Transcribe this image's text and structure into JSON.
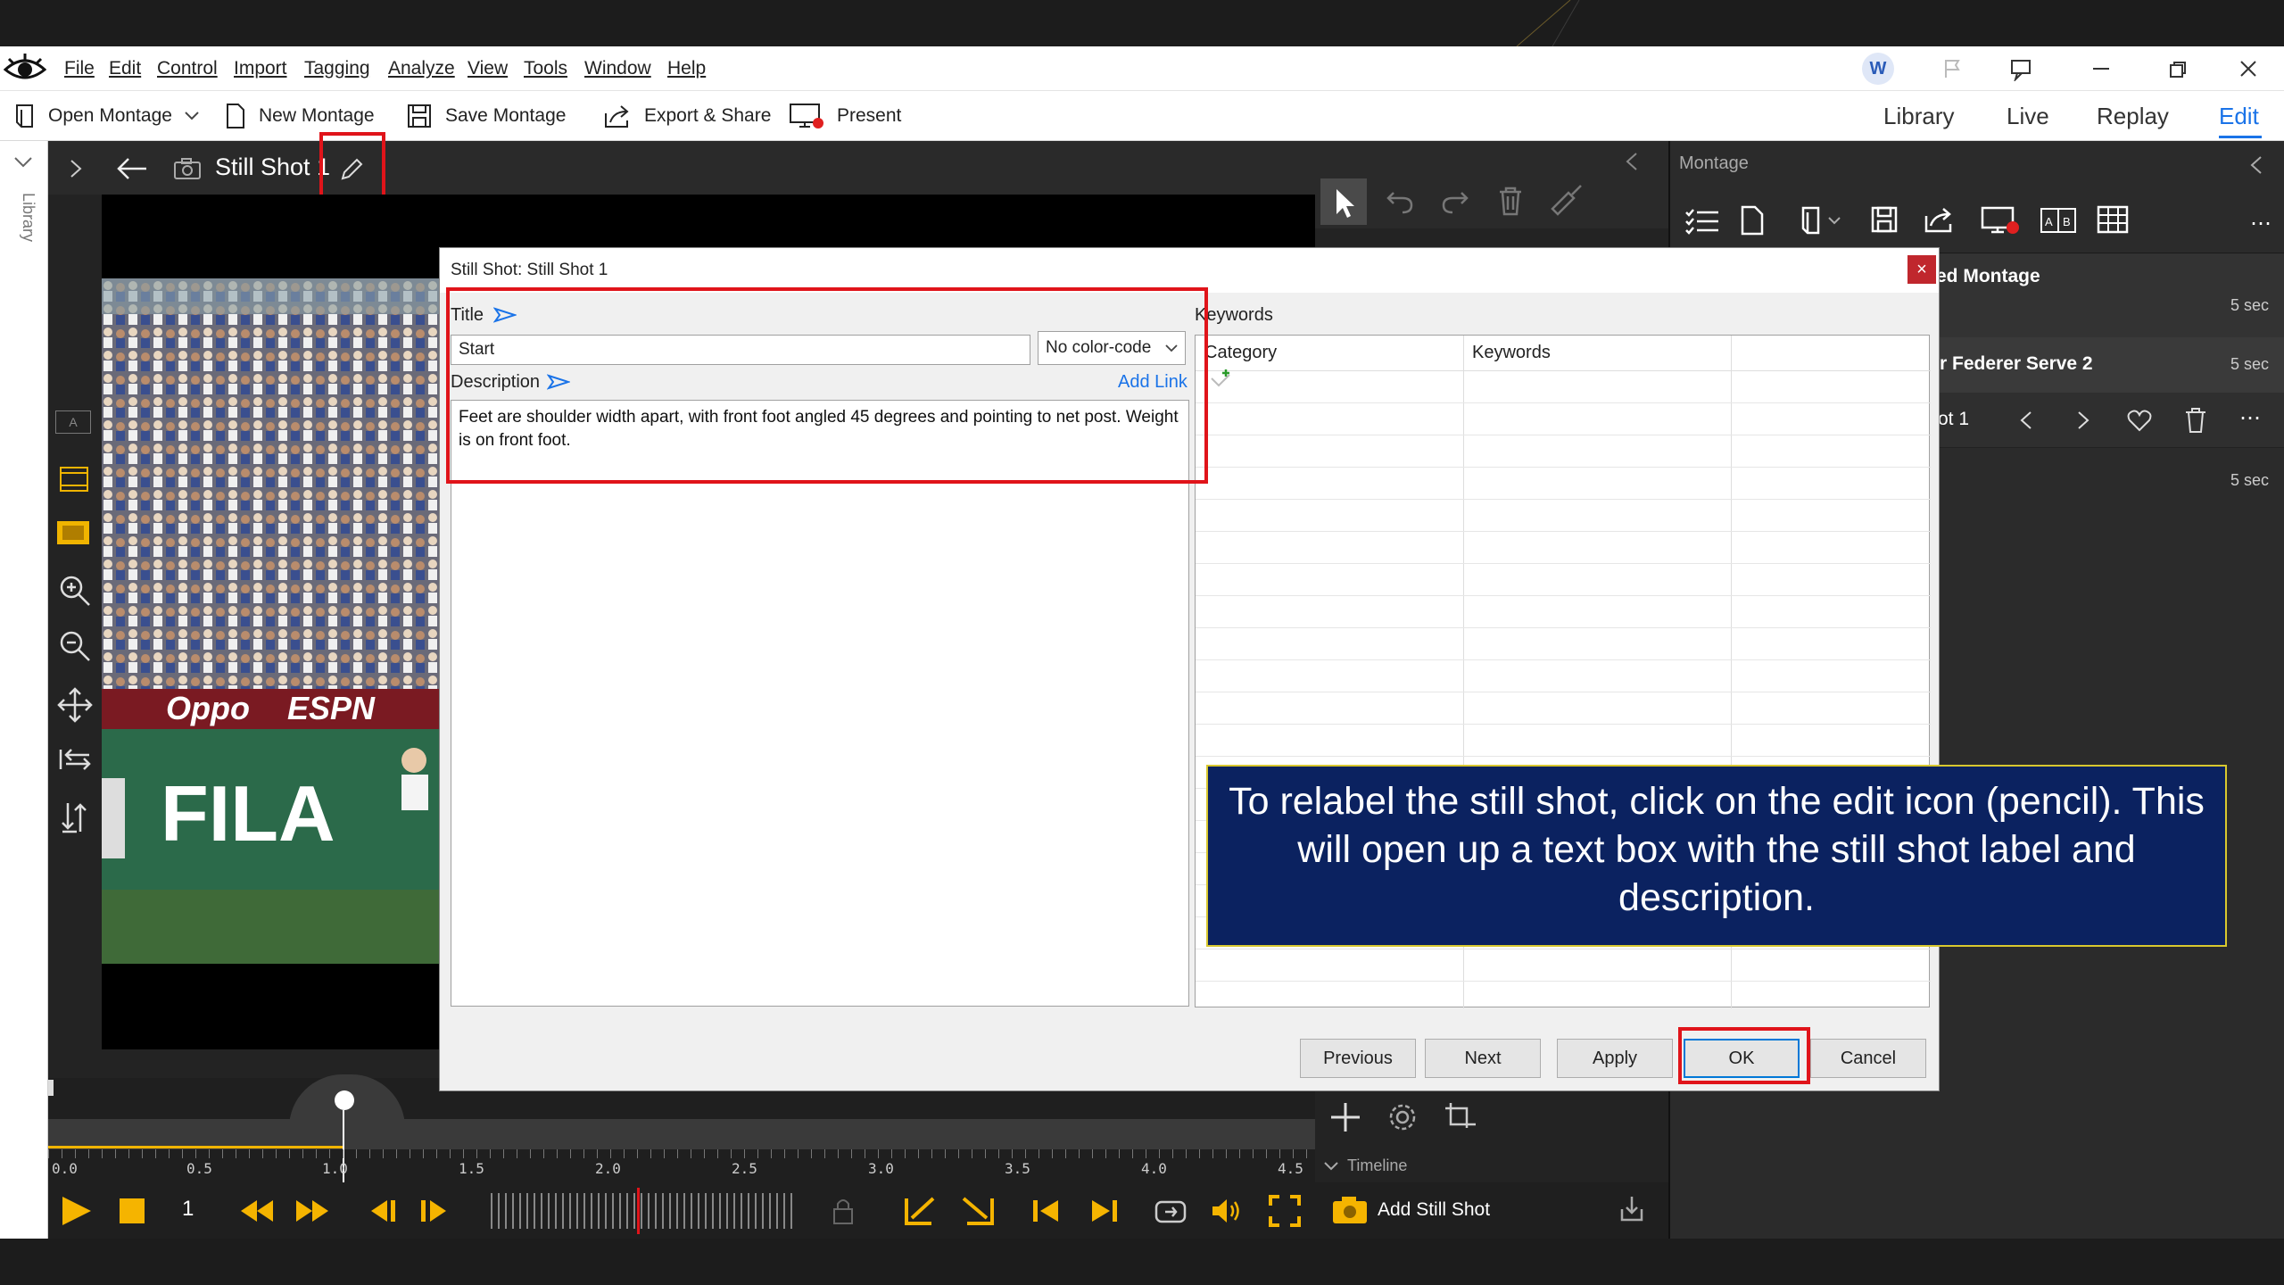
{
  "menu": {
    "items": [
      "File",
      "Edit",
      "Control",
      "Import",
      "Tagging",
      "Analyze",
      "View",
      "Tools",
      "Window",
      "Help"
    ],
    "avatar_letter": "W"
  },
  "toolbar": {
    "open_montage": "Open Montage",
    "new_montage": "New Montage",
    "save_montage": "Save Montage",
    "export_share": "Export & Share",
    "present": "Present",
    "tabs": [
      "Library",
      "Live",
      "Replay",
      "Edit"
    ],
    "active_tab": "Edit"
  },
  "sidebar": {
    "library_label": "Library"
  },
  "viewer": {
    "title": "Still Shot 1",
    "left_tool_a": "A"
  },
  "dialog": {
    "title": "Still Shot: Still Shot 1",
    "title_label": "Title",
    "title_value": "Start",
    "color_code": "No color-code",
    "description_label": "Description",
    "add_link": "Add Link",
    "description_value": "Feet are shoulder width apart, with front foot angled 45 degrees and pointing to net post. Weight is on front foot.",
    "keywords_label": "Keywords",
    "col_category": "Category",
    "col_keywords": "Keywords",
    "buttons": {
      "previous": "Previous",
      "next": "Next",
      "apply": "Apply",
      "ok": "OK",
      "cancel": "Cancel"
    },
    "close": "×"
  },
  "montage": {
    "header": "Montage",
    "rows": [
      {
        "label": "ed Montage",
        "duration": "5 sec"
      },
      {
        "label": "r Federer Serve 2",
        "duration": "5 sec"
      },
      {
        "label": "ot 1",
        "duration": ""
      },
      {
        "label": "",
        "duration": "5 sec"
      }
    ]
  },
  "timeline": {
    "ticks": [
      "0.0",
      "0.5",
      "1.0",
      "1.5",
      "2.0",
      "2.5",
      "3.0",
      "3.5",
      "4.0",
      "4.5"
    ],
    "timeline_label": "Timeline",
    "frame_step": "1",
    "add_still_shot": "Add Still Shot"
  },
  "video": {
    "sponsor1": "FILA",
    "sponsor2": "Oppo",
    "sponsor3": "ESPN"
  },
  "callout": {
    "text": "To relabel the still shot, click on the edit icon (pencil). This will open up a text box with the still shot label and description."
  },
  "colors": {
    "accent": "#1a73e8",
    "highlight": "#e0141a",
    "callout_bg": "#0b2260",
    "play": "#f5b400"
  }
}
